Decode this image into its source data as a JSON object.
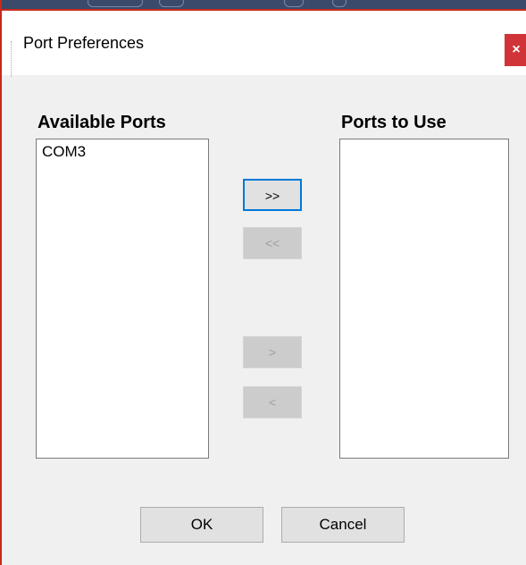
{
  "window": {
    "title": "Port Preferences",
    "close_glyph": "×",
    "accent_color": "#d13438"
  },
  "available": {
    "heading": "Available Ports",
    "items": [
      "COM3"
    ]
  },
  "use": {
    "heading": "Ports to Use",
    "items": []
  },
  "movers": {
    "add_all_label": ">>",
    "remove_all_label": "<<",
    "add_one_label": ">",
    "remove_one_label": "<"
  },
  "buttons": {
    "ok_label": "OK",
    "cancel_label": "Cancel"
  }
}
